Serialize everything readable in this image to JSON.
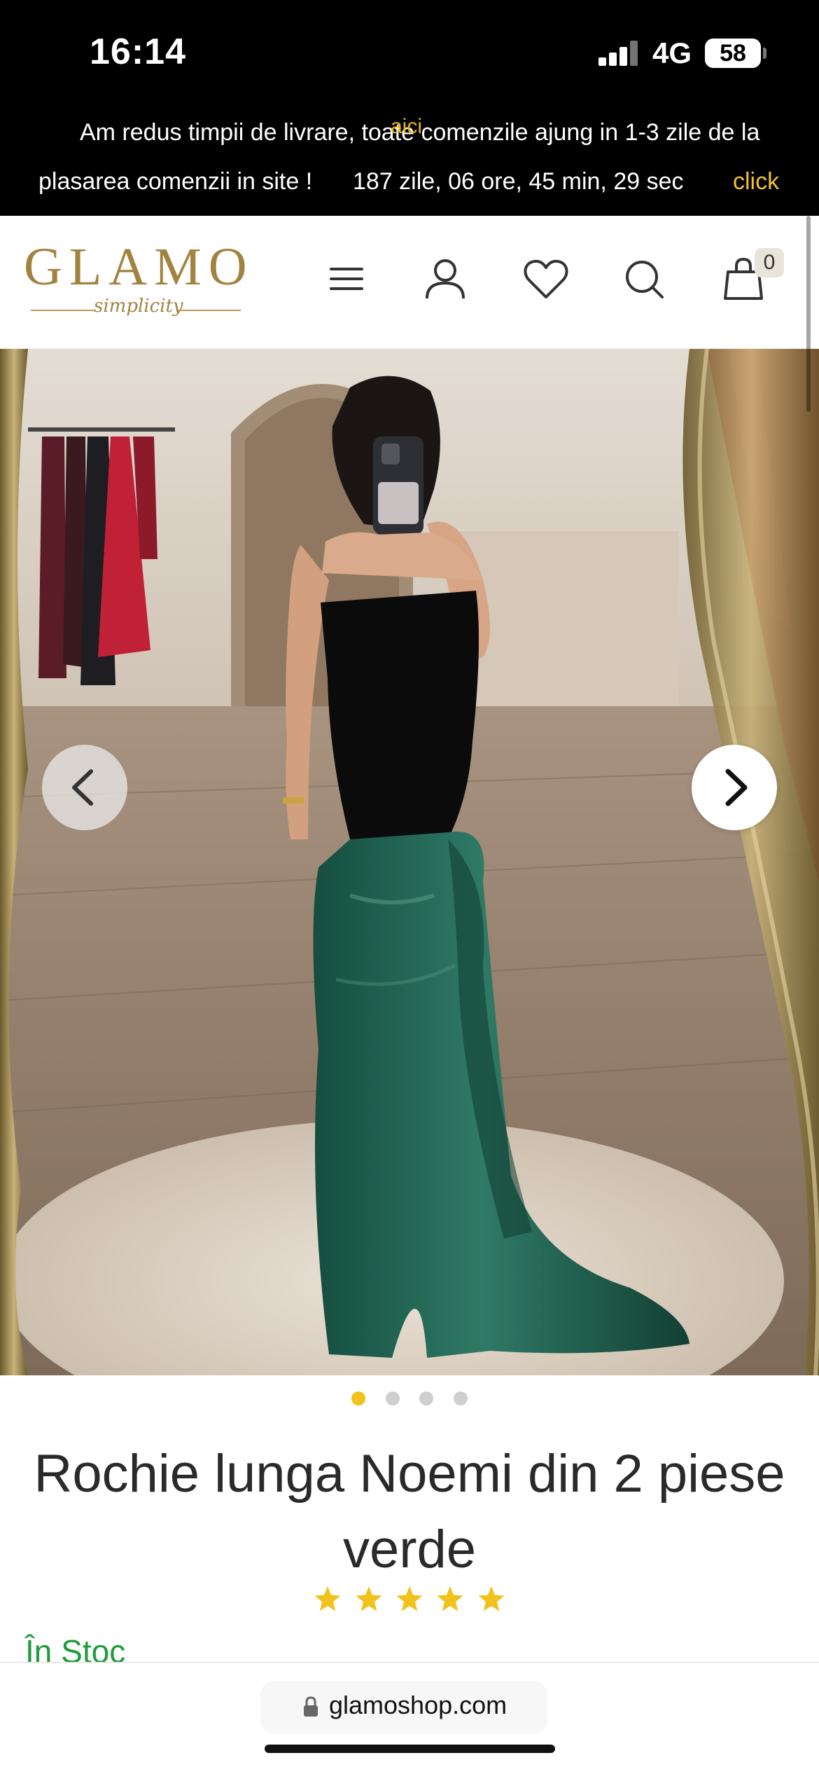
{
  "status_bar": {
    "time": "16:14",
    "network": "4G",
    "battery": "58"
  },
  "promo": {
    "line1": "Am redus timpii de livrare, toate comenzile ajung in 1-3 zile de la",
    "line2": "plasarea comenzii in site !",
    "countdown": "187 zile, 06 ore, 45 min, 29 sec",
    "cta": "click",
    "cta_tail": "aici",
    "cta_color": "#f1c232"
  },
  "header": {
    "logo_text": "GLAMO",
    "logo_sub": "simplicity",
    "cart_count": "0",
    "icons": [
      "menu-icon",
      "user-icon",
      "heart-icon",
      "search-icon",
      "cart-icon"
    ],
    "brand_color": "#a2823f"
  },
  "gallery": {
    "image_count": 4,
    "active_index": 0,
    "active_dot_color": "#f1c21b"
  },
  "product": {
    "title": "Rochie lunga Noemi din 2 piese verde",
    "rating": 5,
    "rating_max": 5,
    "star_color": "#f1c21b",
    "stock": "În Stoc",
    "stock_color": "#1f9b3b"
  },
  "browser": {
    "url": "glamoshop.com"
  }
}
